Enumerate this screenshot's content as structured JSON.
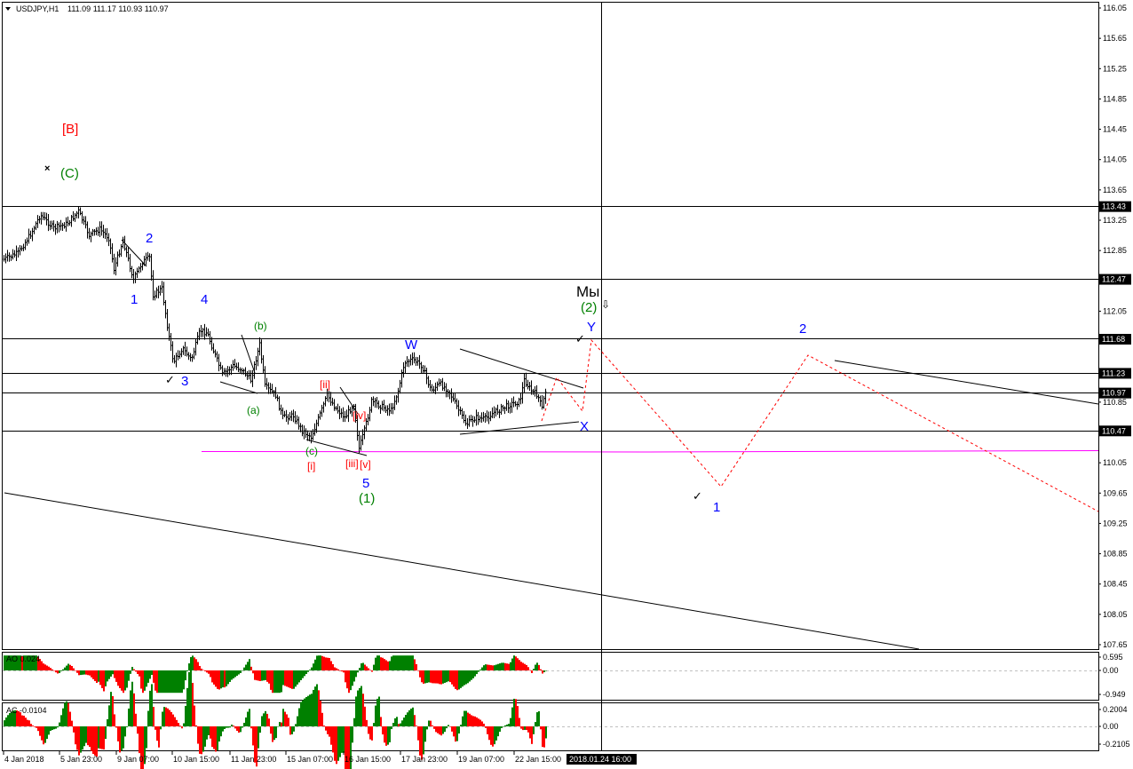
{
  "header": {
    "symbol": "USDJPY,H1",
    "ohlc": "111.09 111.17 110.93 110.97"
  },
  "colors": {
    "background": "#ffffff",
    "grid_frame": "#000000",
    "candle": "#000000",
    "osc_up": "#008000",
    "osc_down": "#ff0000",
    "target_line": "#ff00ff",
    "forecast": "#ff0000",
    "wave_blue": "#0000ff",
    "wave_green": "#008000",
    "wave_red": "#ff0000",
    "price_box_bg": "#000000",
    "price_box_fg": "#ffffff"
  },
  "price_axis": {
    "ticks": [
      "116.05",
      "115.65",
      "115.25",
      "114.85",
      "114.45",
      "114.05",
      "113.65",
      "113.25",
      "112.85",
      "112.05",
      "111.25",
      "110.85",
      "110.05",
      "109.65",
      "109.25",
      "108.85",
      "108.45",
      "108.05",
      "107.65"
    ],
    "boxed": [
      "113.43",
      "112.47",
      "111.68",
      "111.23",
      "110.97",
      "110.47"
    ]
  },
  "time_axis": {
    "ticks": [
      "4 Jan 2018",
      "5 Jan 23:00",
      "9 Jan 07:00",
      "10 Jan 15:00",
      "11 Jan 23:00",
      "15 Jan 07:00",
      "16 Jan 15:00",
      "17 Jan 23:00",
      "19 Jan 07:00",
      "22 Jan 15:00"
    ],
    "cursor": "2018.01.24 16:00"
  },
  "indicators": {
    "ao": {
      "label": "AO 0.024",
      "ticks": [
        "0.595",
        "0.00",
        "-0.949"
      ]
    },
    "ac": {
      "label": "AC -0.0104",
      "ticks": [
        "0.2004",
        "0.00",
        "-0.2105"
      ]
    }
  },
  "wave_labels": {
    "B": "[B]",
    "C": "(C)",
    "blue": {
      "w1": "1",
      "w2": "2",
      "w3": "3",
      "w4": "4",
      "w5": "5",
      "W": "W",
      "X": "X",
      "Y": "Y",
      "f1": "1",
      "f2": "2"
    },
    "green": {
      "a": "(a)",
      "b": "(b)",
      "c": "(c)",
      "one": "(1)",
      "two": "(2)"
    },
    "red": {
      "i": "[i]",
      "ii": "[ii]",
      "iii": "[iii]",
      "iv": "[iv]",
      "v": "[v]"
    },
    "we": "Мы"
  }
}
